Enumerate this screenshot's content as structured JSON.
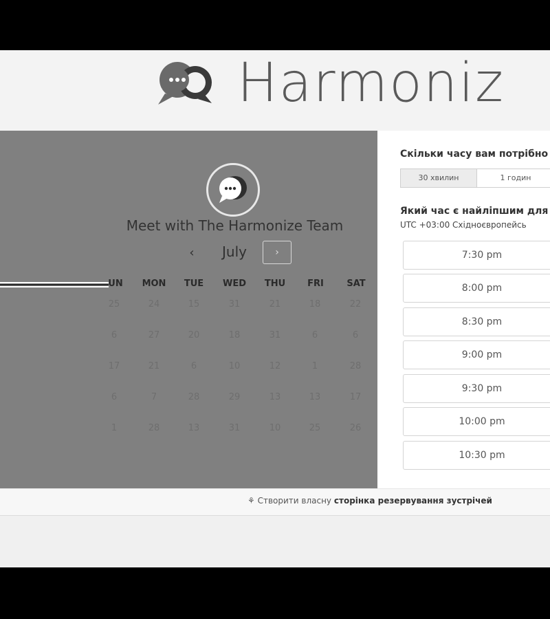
{
  "header": {
    "brand_text": "Harmoniz"
  },
  "calendar": {
    "meeting_title": "Meet with The Harmonize Team",
    "month": "July",
    "prev_icon": "chevron-left-icon",
    "next_icon": "chevron-right-icon",
    "weekdays": [
      "UN",
      "MON",
      "TUE",
      "WED",
      "THU",
      "FRI",
      "SAT"
    ],
    "weeks": [
      [
        "25",
        "24",
        "15",
        "31",
        "21",
        "18",
        "22"
      ],
      [
        "6",
        "27",
        "20",
        "18",
        "31",
        "6",
        "6"
      ],
      [
        "17",
        "21",
        "6",
        "10",
        "12",
        "1",
        "28"
      ],
      [
        "6",
        "7",
        "28",
        "29",
        "13",
        "13",
        "17"
      ],
      [
        "1",
        "28",
        "13",
        "31",
        "10",
        "25",
        "26"
      ]
    ]
  },
  "scheduler": {
    "duration_question": "Скільки часу вам потрібно",
    "durations": [
      "30 хвилин",
      "1 годин"
    ],
    "time_question": "Який час є найліпшим для",
    "timezone": "UTC +03:00 Східноєвропейсь",
    "slots": [
      "7:30 pm",
      "8:00 pm",
      "8:30 pm",
      "9:00 pm",
      "9:30 pm",
      "10:00 pm",
      "10:30 pm"
    ]
  },
  "footer": {
    "icon": "sprocket-icon",
    "prefix": "Створити власну",
    "link": "сторінка резервування зустрічей"
  },
  "colors": {
    "calendar_bg": "#808080",
    "frame": "#000000"
  }
}
